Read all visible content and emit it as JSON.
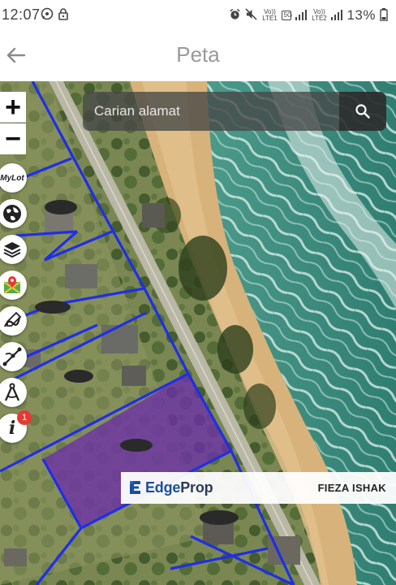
{
  "status_bar": {
    "time": "12:07",
    "battery_percent": "13%",
    "network_label_1": "Vo)) LTE1",
    "network_label_2": "5G",
    "network_label_3": "Vo)) LTE2",
    "icons": [
      "whatsapp-icon",
      "lock-icon",
      "alarm-icon",
      "mute-icon",
      "signal-icon",
      "battery-icon"
    ]
  },
  "app_bar": {
    "title": "Peta",
    "back_icon": "arrow-left-icon"
  },
  "map": {
    "search": {
      "placeholder": "Carian alamat",
      "value": ""
    },
    "search_icon": "magnifier-icon",
    "zoom_in_label": "+",
    "zoom_out_label": "−",
    "tools": [
      {
        "name": "mylot",
        "label": "MyLot"
      },
      {
        "name": "globe-icon"
      },
      {
        "name": "layers-icon"
      },
      {
        "name": "map-pin-icon"
      },
      {
        "name": "draw-icon"
      },
      {
        "name": "measure-icon"
      },
      {
        "name": "compass-icon"
      },
      {
        "name": "info-icon",
        "label": "i",
        "badge": "1"
      }
    ],
    "colors": {
      "parcel_border": "#1f2ee8",
      "highlight_parcel": "#6b2fa8",
      "sea": "#3f8f7f",
      "sand": "#d9b883"
    }
  },
  "watermark": {
    "brand_part1": "Edge",
    "brand_part2": "Prop",
    "agent_name": "FIEZA ISHAK"
  }
}
